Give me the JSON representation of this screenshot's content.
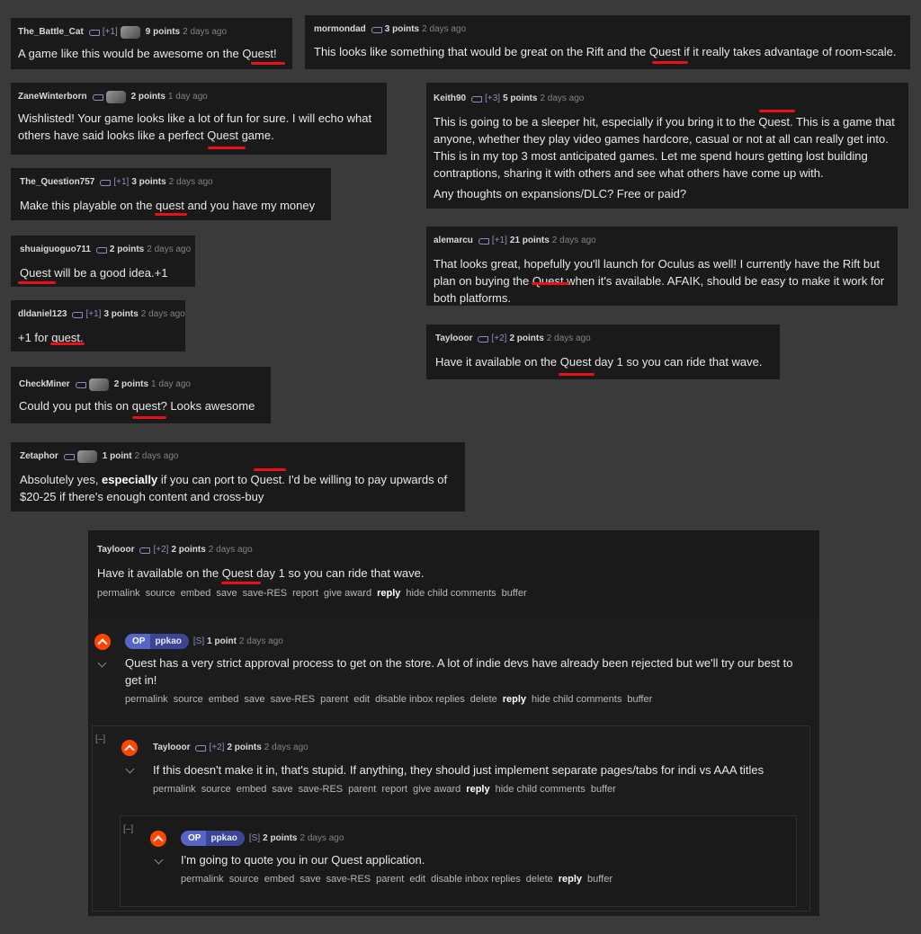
{
  "colors": {
    "background": "#3a3a3a",
    "card": "#1a1a1b",
    "underline": "#e8101a",
    "upvote": "#ff4500",
    "op_badge": "#5865c8"
  },
  "c1": {
    "author": "The_Battle_Cat",
    "flair": "[+1]",
    "points": "9 points",
    "age": "2 days ago",
    "text_a": "A game like this would be awesome on the ",
    "text_u": "Quest!",
    "text_b": ""
  },
  "c2": {
    "author": "mormondad",
    "points": "3 points",
    "age": "2 days ago",
    "text_a": "This looks like something that would be great on the Rift and the ",
    "text_u": "Quest",
    "text_b": " if it really takes advantage of room-scale."
  },
  "c3": {
    "author": "ZaneWinterborn",
    "points": "2 points",
    "age": "1 day ago",
    "line1": "Wishlisted! Your game looks like a lot of fun for sure. I will echo what",
    "text_a": "others have said looks like a perfect ",
    "text_u": "Quest",
    "text_b": " game."
  },
  "c4": {
    "author": "Keith90",
    "flair": "[+3]",
    "points": "5 points",
    "age": "2 days ago",
    "text_a": "This is going to be a sleeper hit, especially if you bring it to the ",
    "text_u": "Quest",
    "text_b": ". This is a game that",
    "line2": "anyone, whether they play video games hardcore, casual or not at all can really get into.",
    "line3": "This is in my top 3 most anticipated games. Let me spend hours getting lost building",
    "line4": "contraptions, sharing it with others and see what others have come up with.",
    "line5": "Any thoughts on expansions/DLC? Free or paid?"
  },
  "c5": {
    "author": "The_Question757",
    "flair": "[+1]",
    "points": "3 points",
    "age": "2 days ago",
    "text_a": "Make this playable on the ",
    "text_u": "quest",
    "text_b": " and you have my money"
  },
  "c6": {
    "author": "alemarcu",
    "flair": "[+1]",
    "points": "21 points",
    "age": "2 days ago",
    "line1": "That looks great, hopefully you'll launch for Oculus as well! I currently have the Rift but",
    "text_a": "plan on buying the ",
    "text_u": "Quest",
    "text_b": " when it's available. AFAIK, should be easy to make it work for",
    "line3": "both platforms."
  },
  "c7": {
    "author": "shuaiguoguo711",
    "points": "2 points",
    "age": "2 days ago",
    "text_a": "",
    "text_u": "Quest",
    "text_b": " will be a good idea.+1"
  },
  "c8": {
    "author": "dldaniel123",
    "flair": "[+1]",
    "points": "3 points",
    "age": "2 days ago",
    "text_a": "+1 for ",
    "text_u": "quest",
    "text_b": "."
  },
  "c9": {
    "author": "Taylooor",
    "flair": "[+2]",
    "points": "2 points",
    "age": "2 days ago",
    "text_a": "Have it available on the ",
    "text_u": "Quest",
    "text_b": " day 1 so you can ride that wave."
  },
  "c10": {
    "author": "CheckMiner",
    "points": "2 points",
    "age": "1 day ago",
    "text_a": "Could you put this on ",
    "text_u": "quest",
    "text_b": "? Looks awesome"
  },
  "c11": {
    "author": "Zetaphor",
    "points": "1 point",
    "age": "2 days ago",
    "text_a": "Absolutely yes, ",
    "text_bold": "especially",
    "text_c": " if you can port to ",
    "text_u": "Quest",
    "text_b": ". I'd be willing to pay upwards of",
    "line2": "$20-25 if there's enough content and cross-buy"
  },
  "thread": {
    "root": {
      "author": "Taylooor",
      "flair": "[+2]",
      "points": "2 points",
      "age": "2 days ago",
      "text_a": "Have it available on the ",
      "text_u": "Quest",
      "text_b": " day 1 so you can ride that wave.",
      "actions": [
        "permalink",
        "source",
        "embed",
        "save",
        "save-RES",
        "report",
        "give award",
        "reply",
        "hide child comments",
        "buffer"
      ]
    },
    "op1": {
      "op": "OP",
      "author": "ppkao",
      "flair": "[S]",
      "points": "1 point",
      "age": "2 days ago",
      "line1": "Quest has a very strict approval process to get on the store. A lot of indie devs have already been rejected but we'll try our best to",
      "line2": "get in!",
      "actions": [
        "permalink",
        "source",
        "embed",
        "save",
        "save-RES",
        "parent",
        "edit",
        "disable inbox replies",
        "delete",
        "reply",
        "hide child comments",
        "buffer"
      ]
    },
    "reply1": {
      "collapse": "[–]",
      "author": "Taylooor",
      "flair": "[+2]",
      "points": "2 points",
      "age": "2 days ago",
      "line1": "If this doesn't make it in, that's stupid. If anything, they should just implement separate pages/tabs for indi vs AAA titles",
      "actions": [
        "permalink",
        "source",
        "embed",
        "save",
        "save-RES",
        "parent",
        "report",
        "give award",
        "reply",
        "hide child comments",
        "buffer"
      ]
    },
    "op2": {
      "collapse": "[–]",
      "op": "OP",
      "author": "ppkao",
      "flair": "[S]",
      "points": "2 points",
      "age": "2 days ago",
      "line1": "I'm going to quote you in our Quest application.",
      "actions": [
        "permalink",
        "source",
        "embed",
        "save",
        "save-RES",
        "parent",
        "edit",
        "disable inbox replies",
        "delete",
        "reply",
        "buffer"
      ]
    }
  }
}
